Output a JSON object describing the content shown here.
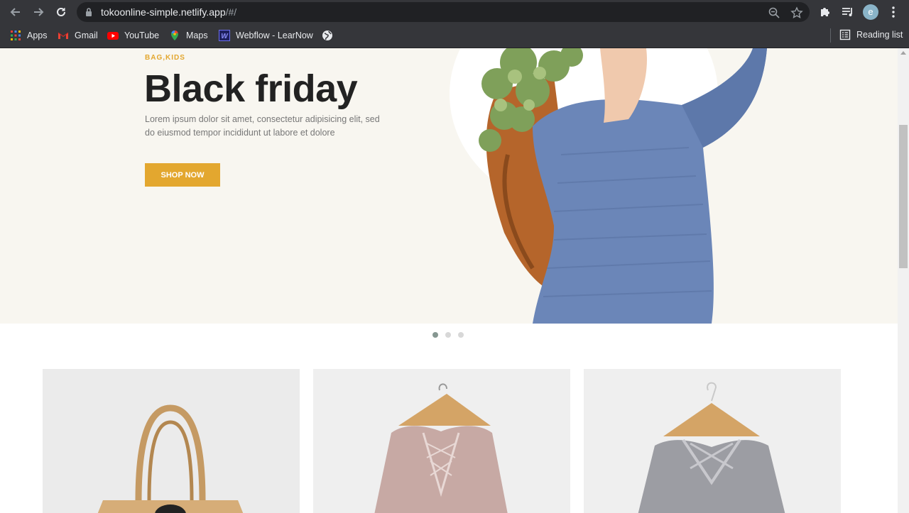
{
  "browser": {
    "url_main": "tokoonline-simple.netlify.app",
    "url_path": "/#/",
    "avatar_letter": "e",
    "bookmarks": [
      {
        "label": "Apps",
        "icon": "apps-grid-icon"
      },
      {
        "label": "Gmail",
        "icon": "gmail-icon"
      },
      {
        "label": "YouTube",
        "icon": "youtube-icon"
      },
      {
        "label": "Maps",
        "icon": "maps-pin-icon"
      },
      {
        "label": "Webflow - LearNow",
        "icon": "webflow-icon"
      },
      {
        "label": "",
        "icon": "globe-icon"
      }
    ],
    "reading_list": "Reading list"
  },
  "hero": {
    "tag": "BAG,KIDS",
    "title": "Black friday",
    "description": "Lorem ipsum dolor sit amet, consectetur adipisicing elit, sed do eiusmod tempor incididunt ut labore et dolore",
    "cta": "SHOP NOW",
    "accent_color": "#e3a72f",
    "slides_total": 3,
    "active_slide": 1
  },
  "products": [
    {
      "image": "tan tote bag"
    },
    {
      "image": "pink lace-up sweater on hanger"
    },
    {
      "image": "grey sweater on hanger"
    }
  ]
}
